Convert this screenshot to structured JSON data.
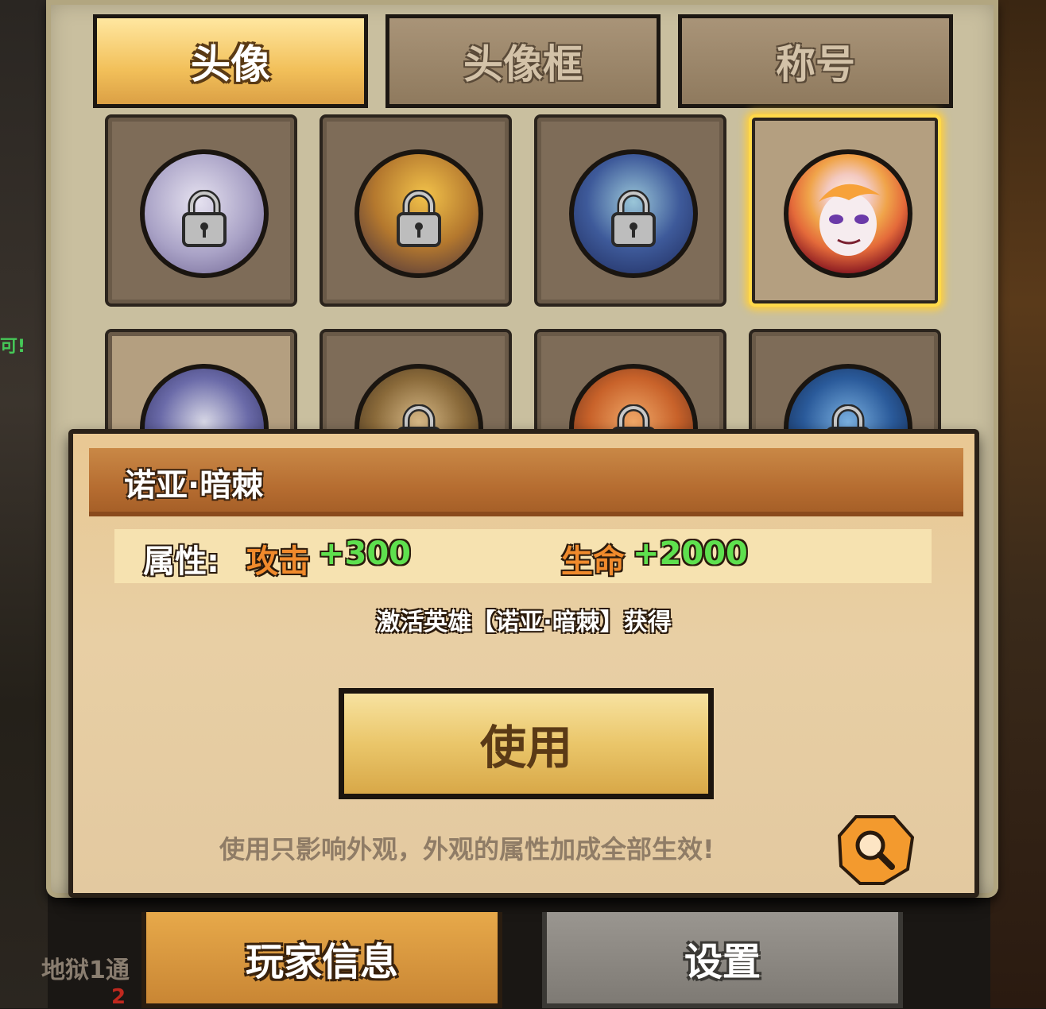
{
  "tabs": [
    {
      "label": "头像",
      "active": true
    },
    {
      "label": "头像框",
      "active": false
    },
    {
      "label": "称号",
      "active": false
    }
  ],
  "avatars": [
    {
      "hero": "pale-elf",
      "locked": true
    },
    {
      "hero": "blonde-warrior",
      "locked": true
    },
    {
      "hero": "blue-haired-elf",
      "locked": true
    },
    {
      "hero": "noah-darkthorn",
      "locked": false,
      "selected": true
    },
    {
      "hero": "masked-knight",
      "locked": false
    },
    {
      "hero": "helmed-warrior",
      "locked": true
    },
    {
      "hero": "orange-haired-hero",
      "locked": true
    },
    {
      "hero": "golden-crest",
      "locked": true
    }
  ],
  "detail": {
    "name": "诺亚·暗棘",
    "stats_label": "属性:",
    "stat1_name": "攻击",
    "stat1_value": "+300",
    "stat2_name": "生命",
    "stat2_value": "+2000",
    "source": "激活英雄【诺亚·暗棘】获得",
    "use_button": "使用",
    "note": "使用只影响外观，外观的属性加成全部生效!"
  },
  "bottom_buttons": {
    "player_info": "玩家信息",
    "settings": "设置"
  },
  "background": {
    "left_text": "地狱1通",
    "left_red": "2"
  },
  "colors": {
    "accent_gold": "#ffd94a",
    "attack_orange": "#f08a2c",
    "bonus_green": "#5ee04e"
  }
}
